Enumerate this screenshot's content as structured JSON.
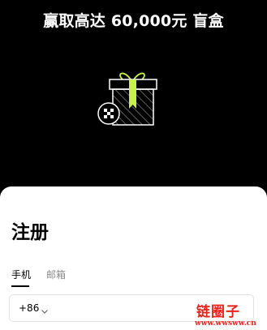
{
  "promo": {
    "title": "赢取高达 60,000元 盲盒"
  },
  "colors": {
    "background": "#000000",
    "accent": "#c8f04a",
    "sheet": "#ffffff",
    "watermark": "#e8231e"
  },
  "register": {
    "title": "注册",
    "tabs": [
      {
        "label": "手机",
        "active": true
      },
      {
        "label": "邮箱",
        "active": false
      }
    ],
    "phone": {
      "country_code": "+86"
    }
  },
  "watermark": {
    "brand": "链圈子",
    "url": "www.wwsww.cn"
  }
}
